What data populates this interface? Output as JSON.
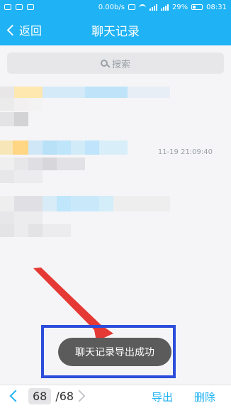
{
  "statusbar": {
    "speed": "0.00b/s",
    "battery": "29%",
    "time": "08:31"
  },
  "header": {
    "back_label": "返回",
    "title": "聊天记录"
  },
  "search": {
    "placeholder": "搜索"
  },
  "messages": [
    {
      "time": "11-19 21:09:40"
    }
  ],
  "toast": {
    "text": "聊天记录导出成功"
  },
  "footer": {
    "current_page": "68",
    "total_pages": "/68",
    "export_label": "导出",
    "delete_label": "删除"
  },
  "colors": {
    "primary": "#1fb2f4",
    "highlight_border": "#2d4ddb",
    "arrow": "#e53935"
  },
  "icons": {
    "back": "chevron-left-icon",
    "search": "search-icon",
    "prev": "chevron-left-icon",
    "next": "chevron-right-icon"
  }
}
